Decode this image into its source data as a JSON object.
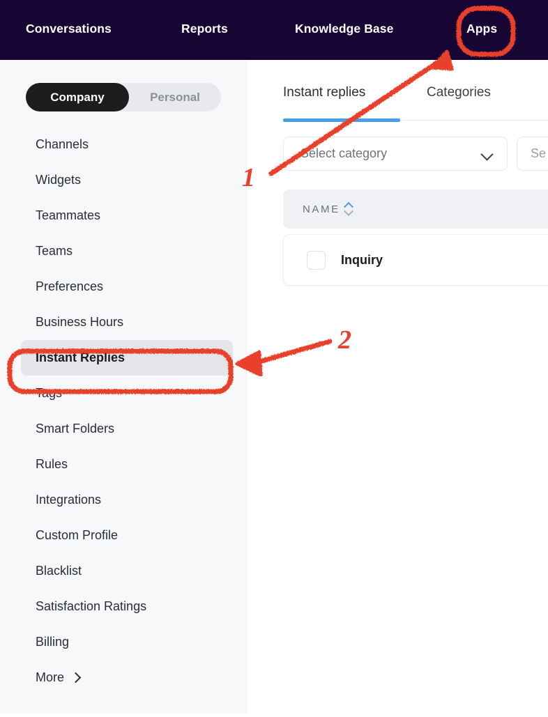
{
  "topnav": {
    "background": "#170633",
    "items": [
      {
        "label": "Conversations",
        "name": "nav-item-conversations"
      },
      {
        "label": "Reports",
        "name": "nav-item-reports"
      },
      {
        "label": "Knowledge Base",
        "name": "nav-item-knowledge-base"
      },
      {
        "label": "Apps",
        "name": "nav-item-apps"
      }
    ]
  },
  "sidebar": {
    "background": "#F7F8FA",
    "scope_toggle": {
      "company_label": "Company",
      "personal_label": "Personal",
      "selected": "Company"
    },
    "items": [
      {
        "label": "Channels",
        "active": false
      },
      {
        "label": "Widgets",
        "active": false
      },
      {
        "label": "Teammates",
        "active": false
      },
      {
        "label": "Teams",
        "active": false
      },
      {
        "label": "Preferences",
        "active": false
      },
      {
        "label": "Business Hours",
        "active": false
      },
      {
        "label": "Instant Replies",
        "active": true
      },
      {
        "label": "Tags",
        "active": false
      },
      {
        "label": "Smart Folders",
        "active": false
      },
      {
        "label": "Rules",
        "active": false
      },
      {
        "label": "Integrations",
        "active": false
      },
      {
        "label": "Custom Profile",
        "active": false
      },
      {
        "label": "Blacklist",
        "active": false
      },
      {
        "label": "Satisfaction Ratings",
        "active": false
      },
      {
        "label": "Billing",
        "active": false
      },
      {
        "label": "More",
        "active": false,
        "icon": "chevron-right-icon"
      }
    ]
  },
  "main": {
    "tabs": [
      {
        "label": "Instant replies",
        "active": true
      },
      {
        "label": "Categories",
        "active": false
      }
    ],
    "accent_color": "#4A9FE4",
    "category_select": {
      "value": "Select category",
      "icon": "chevron-down-icon"
    },
    "search": {
      "placeholder": "Se"
    },
    "table": {
      "columns": [
        {
          "label": "NAME",
          "sort_icon": "sort-arrows-icon",
          "sort_direction": "asc"
        }
      ],
      "rows": [
        {
          "checked": false,
          "name": "Inquiry"
        }
      ]
    }
  },
  "annotations": {
    "color": "#E8402A",
    "markers": [
      {
        "number": "1",
        "target": "nav-item-apps",
        "shape": "arrow-up-right"
      },
      {
        "number": "2",
        "target": "sidebar-item-instant-replies",
        "shape": "arrow-left"
      }
    ],
    "highlights": [
      {
        "shape": "rounded-oval",
        "target": "nav-item-apps"
      },
      {
        "shape": "rounded-rect",
        "target": "sidebar-item-instant-replies"
      }
    ]
  }
}
